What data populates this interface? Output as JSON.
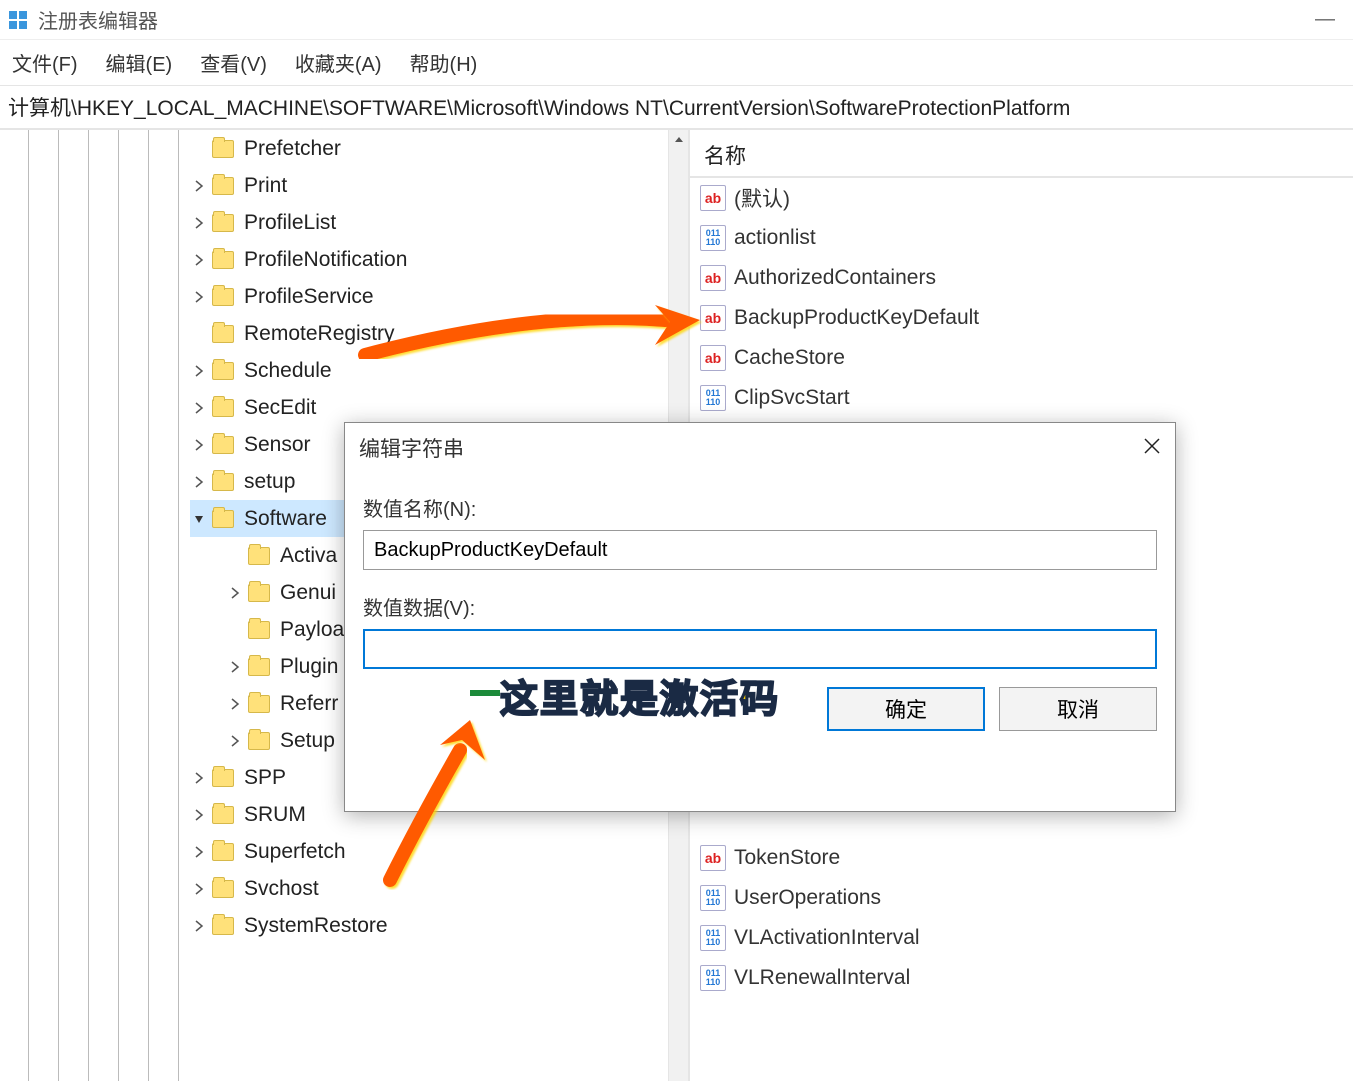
{
  "window": {
    "title": "注册表编辑器",
    "minimize": "—"
  },
  "menu": {
    "file": "文件(F)",
    "edit": "编辑(E)",
    "view": "查看(V)",
    "favorites": "收藏夹(A)",
    "help": "帮助(H)"
  },
  "address": "计算机\\HKEY_LOCAL_MACHINE\\SOFTWARE\\Microsoft\\Windows NT\\CurrentVersion\\SoftwareProtectionPlatform",
  "tree": {
    "items": [
      {
        "label": "Prefetcher",
        "expander": "none",
        "child": false
      },
      {
        "label": "Print",
        "expander": "closed",
        "child": false
      },
      {
        "label": "ProfileList",
        "expander": "closed",
        "child": false
      },
      {
        "label": "ProfileNotification",
        "expander": "closed",
        "child": false
      },
      {
        "label": "ProfileService",
        "expander": "closed",
        "child": false
      },
      {
        "label": "RemoteRegistry",
        "expander": "none",
        "child": false
      },
      {
        "label": "Schedule",
        "expander": "closed",
        "child": false
      },
      {
        "label": "SecEdit",
        "expander": "closed",
        "child": false
      },
      {
        "label": "Sensor",
        "expander": "closed",
        "child": false
      },
      {
        "label": "setup",
        "expander": "closed",
        "child": false
      },
      {
        "label": "Software",
        "expander": "open",
        "child": false,
        "selected": true
      },
      {
        "label": "Activa",
        "expander": "none",
        "child": true
      },
      {
        "label": "Genui",
        "expander": "closed",
        "child": true
      },
      {
        "label": "Payloa",
        "expander": "none",
        "child": true
      },
      {
        "label": "Plugin",
        "expander": "closed",
        "child": true
      },
      {
        "label": "Referr",
        "expander": "closed",
        "child": true
      },
      {
        "label": "Setup",
        "expander": "closed",
        "child": true
      },
      {
        "label": "SPP",
        "expander": "closed",
        "child": false
      },
      {
        "label": "SRUM",
        "expander": "closed",
        "child": false
      },
      {
        "label": "Superfetch",
        "expander": "closed",
        "child": false
      },
      {
        "label": "Svchost",
        "expander": "closed",
        "child": false
      },
      {
        "label": "SystemRestore",
        "expander": "closed",
        "child": false
      }
    ]
  },
  "values": {
    "header": "名称",
    "items": [
      {
        "icon": "str",
        "label": "(默认)"
      },
      {
        "icon": "bin",
        "label": "actionlist"
      },
      {
        "icon": "str",
        "label": "AuthorizedContainers"
      },
      {
        "icon": "str",
        "label": "BackupProductKeyDefault"
      },
      {
        "icon": "str",
        "label": "CacheStore"
      },
      {
        "icon": "bin",
        "label": "ClipSvcStart"
      },
      {
        "icon": "str",
        "label": "TokenStore"
      },
      {
        "icon": "bin",
        "label": "UserOperations"
      },
      {
        "icon": "bin",
        "label": "VLActivationInterval"
      },
      {
        "icon": "bin",
        "label": "VLRenewalInterval"
      }
    ]
  },
  "dialog": {
    "title": "编辑字符串",
    "name_label": "数值名称(N):",
    "name_value": "BackupProductKeyDefault",
    "data_label": "数值数据(V):",
    "data_value": "",
    "ok": "确定",
    "cancel": "取消"
  },
  "annotation": {
    "text": "这里就是激活码"
  }
}
